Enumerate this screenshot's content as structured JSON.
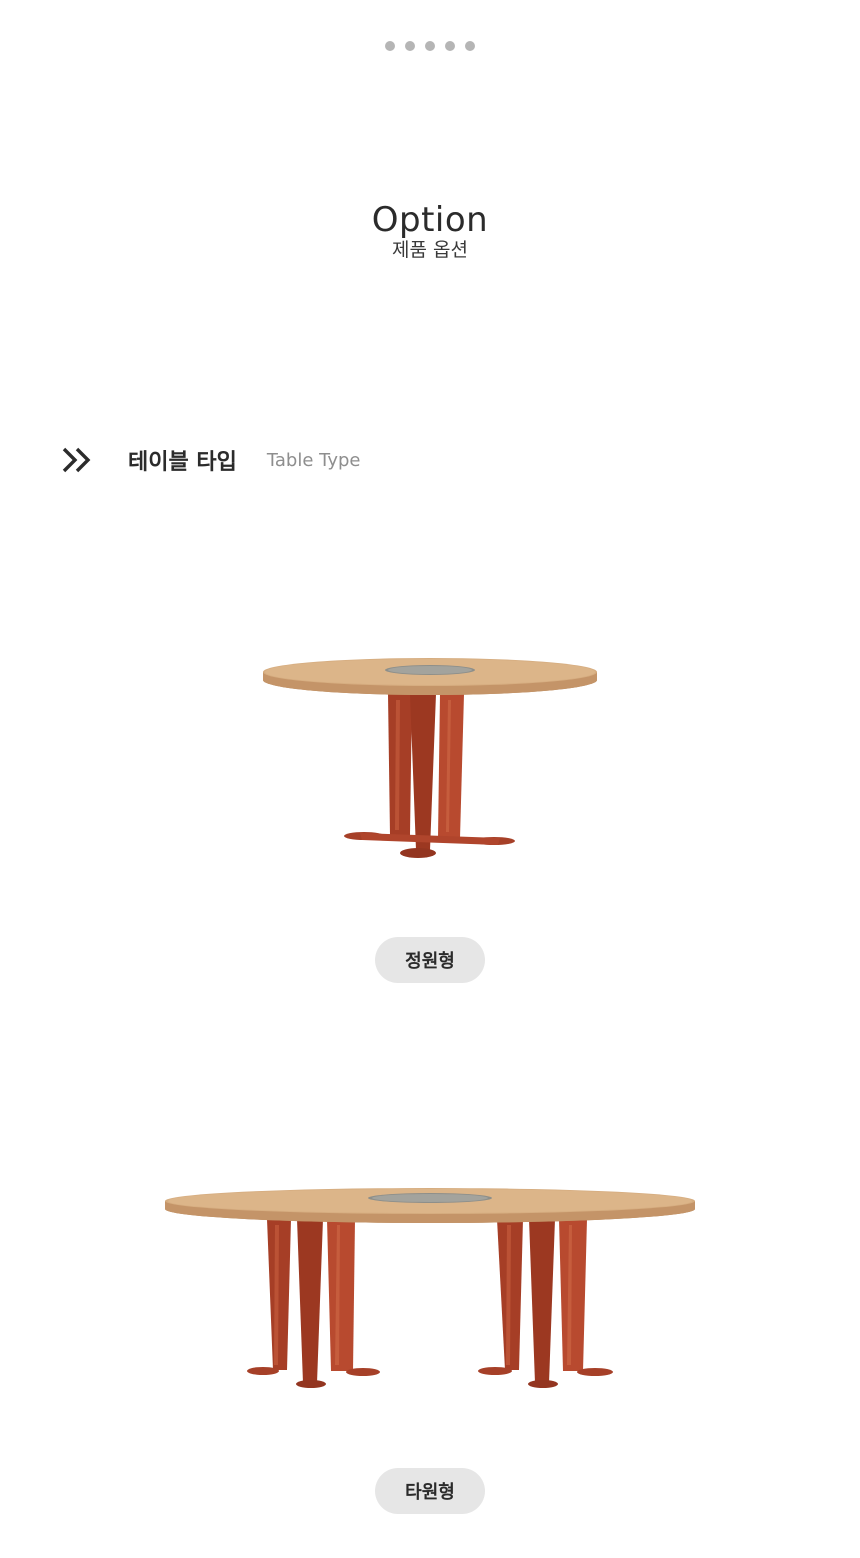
{
  "pagination": {
    "dot_count": 5
  },
  "header": {
    "title": "Option",
    "subtitle": "제품 옵션"
  },
  "section": {
    "title_ko": "테이블 타입",
    "title_en": "Table Type",
    "icon": "double-chevron-right-icon"
  },
  "products": [
    {
      "label": "정원형",
      "image": "round-table-image"
    },
    {
      "label": "타원형",
      "image": "oval-table-image"
    }
  ],
  "colors": {
    "tabletop": "#d6ad80",
    "tabletop_edge": "#b98a5c",
    "legs": "#b2462c",
    "pill_bg": "#e6e6e6",
    "dots": "#b5b5b5"
  }
}
